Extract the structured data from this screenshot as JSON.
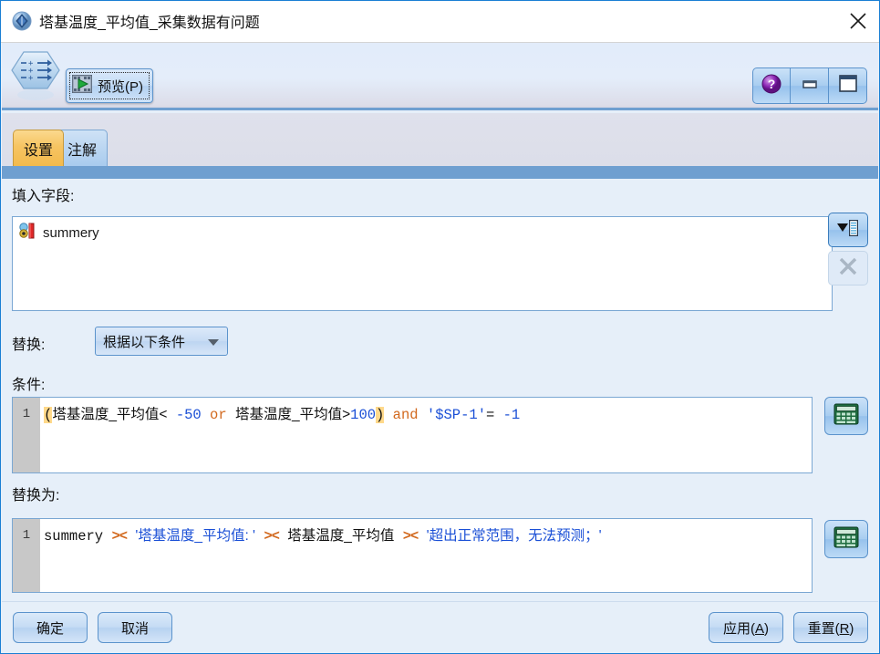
{
  "window": {
    "title": "塔基温度_平均值_采集数据有问题",
    "title_icon": "node-diamond-icon",
    "close_label": "✕"
  },
  "toolbar": {
    "node_icon": "derive-node-icon",
    "preview_label": "预览(P)",
    "preview_icon": "play-green-icon",
    "help_icon": "help-question-icon",
    "minimize_icon": "minimize-icon",
    "maximize_icon": "maximize-icon"
  },
  "tabs": [
    {
      "label": "设置",
      "active": true
    },
    {
      "label": "注解",
      "active": false
    }
  ],
  "main": {
    "fill_fields_label": "填入字段:",
    "field_list": [
      {
        "name": "summery",
        "type_icon": "nominal-field-icon"
      }
    ],
    "field_chooser_icon": "field-chooser-icon",
    "delete_icon": "delete-x-icon",
    "replace_label": "替换:",
    "replace_mode": "根据以下条件",
    "replace_mode_caret": "chevron-down-icon",
    "condition_label": "条件:",
    "condition": {
      "line_number": "1",
      "text": "(塔基温度_平均值< -50 or 塔基温度_平均值>100) and  '$SP-1'= -1",
      "tokens": [
        {
          "t": "(",
          "k": "paren-hl"
        },
        {
          "t": "塔基温度_平均值<",
          "k": "cn"
        },
        {
          "t": " "
        },
        {
          "t": "-50",
          "k": "num"
        },
        {
          "t": " "
        },
        {
          "t": "or",
          "k": "kw"
        },
        {
          "t": " "
        },
        {
          "t": "塔基温度_平均值>",
          "k": "cn"
        },
        {
          "t": "100",
          "k": "num"
        },
        {
          "t": ")",
          "k": "paren-hl"
        },
        {
          "t": " "
        },
        {
          "t": "and",
          "k": "kw"
        },
        {
          "t": "  "
        },
        {
          "t": "'$SP-1'",
          "k": "str"
        },
        {
          "t": "= "
        },
        {
          "t": "-1",
          "k": "num"
        }
      ]
    },
    "replace_with_label": "替换为:",
    "replace_with": {
      "line_number": "1",
      "text": "summery >< '塔基温度_平均值: ' >< 塔基温度_平均值  >< '超出正常范围，无法预测；'",
      "tokens": [
        {
          "t": "summery"
        },
        {
          "t": " "
        },
        {
          "t": "><",
          "k": "op-cat"
        },
        {
          "t": " "
        },
        {
          "t": "'塔基温度_平均值: '",
          "k": "str cn"
        },
        {
          "t": "  "
        },
        {
          "t": "><",
          "k": "op-cat"
        },
        {
          "t": " "
        },
        {
          "t": "塔基温度_平均值",
          "k": "cn"
        },
        {
          "t": "   "
        },
        {
          "t": "><",
          "k": "op-cat"
        },
        {
          "t": " "
        },
        {
          "t": "'超出正常范围，无法预测；'",
          "k": "str cn"
        }
      ]
    },
    "calculator_icon": "calculator-icon"
  },
  "footer": {
    "ok_label": "确定",
    "cancel_label": "取消",
    "apply_label_pre": "应用(",
    "apply_mnemonic": "A",
    "apply_label_post": ")",
    "reset_label_pre": "重置(",
    "reset_mnemonic": "R",
    "reset_label_post": ")"
  },
  "colors": {
    "accent_blue": "#6f9fd0",
    "active_tab": "#f3ba4c",
    "panel_bg": "#e6eff9",
    "keyword": "#d2691e",
    "number": "#1a4fd6",
    "bracket_highlight": "#ffd98a"
  }
}
